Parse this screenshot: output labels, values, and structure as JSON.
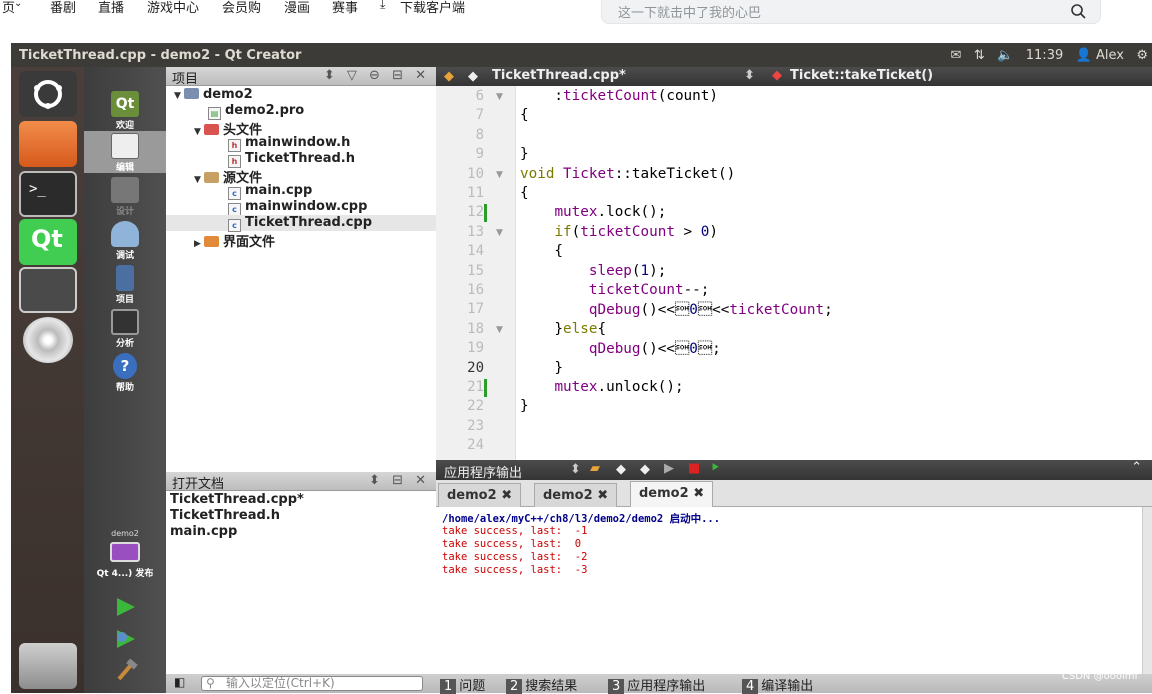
{
  "topnav": {
    "items": [
      "页",
      "番剧",
      "直播",
      "游戏中心",
      "会员购",
      "漫画",
      "赛事",
      "下载客户端"
    ],
    "search_placeholder": "这一下就击中了我的心巴"
  },
  "window": {
    "title": "TicketThread.cpp - demo2 - Qt Creator",
    "clock": "11:39",
    "user": "Alex"
  },
  "modes": [
    {
      "label": "欢迎",
      "color": "#6a8e3a"
    },
    {
      "label": "编辑",
      "color": "#eeeeee"
    },
    {
      "label": "设计",
      "color": "#777777"
    },
    {
      "label": "调试",
      "color": "#8fb3d9"
    },
    {
      "label": "项目",
      "color": "#4a6fa0"
    },
    {
      "label": "分析",
      "color": "#333333"
    },
    {
      "label": "帮助",
      "color": "#3a6fc0"
    }
  ],
  "target": {
    "project": "demo2",
    "kit": "Qt 4...) 发布"
  },
  "project_pane": {
    "title": "项目",
    "tree": [
      {
        "text": "demo2",
        "level": 0,
        "kind": "project",
        "arrow": "▼"
      },
      {
        "text": "demo2.pro",
        "level": 1,
        "kind": "pro",
        "arrow": ""
      },
      {
        "text": "头文件",
        "level": 1,
        "kind": "folder",
        "arrow": "▼"
      },
      {
        "text": "mainwindow.h",
        "level": 2,
        "kind": "h",
        "arrow": ""
      },
      {
        "text": "TicketThread.h",
        "level": 2,
        "kind": "h",
        "arrow": ""
      },
      {
        "text": "源文件",
        "level": 1,
        "kind": "folder",
        "arrow": "▼"
      },
      {
        "text": "main.cpp",
        "level": 2,
        "kind": "cpp",
        "arrow": ""
      },
      {
        "text": "mainwindow.cpp",
        "level": 2,
        "kind": "cpp",
        "arrow": ""
      },
      {
        "text": "TicketThread.cpp",
        "level": 2,
        "kind": "cpp",
        "arrow": "",
        "selected": true
      },
      {
        "text": "界面文件",
        "level": 1,
        "kind": "folder",
        "arrow": "▶"
      }
    ]
  },
  "open_docs": {
    "title": "打开文档",
    "files": [
      "TicketThread.cpp*",
      "TicketThread.h",
      "main.cpp"
    ]
  },
  "editor": {
    "file_tab": "TicketThread.cpp*",
    "symbol": "Ticket::takeTicket()",
    "current_line": 20,
    "lines": [
      {
        "n": 6,
        "code": "    :ticketCount(count)"
      },
      {
        "n": 7,
        "code": "{"
      },
      {
        "n": 8,
        "code": ""
      },
      {
        "n": 9,
        "code": "}"
      },
      {
        "n": 10,
        "code": "void Ticket::takeTicket()"
      },
      {
        "n": 11,
        "code": "{"
      },
      {
        "n": 12,
        "code": "    mutex.lock();"
      },
      {
        "n": 13,
        "code": "    if(ticketCount > 0)"
      },
      {
        "n": 14,
        "code": "    {"
      },
      {
        "n": 15,
        "code": "        sleep(1);"
      },
      {
        "n": 16,
        "code": "        ticketCount--;"
      },
      {
        "n": 17,
        "code": "        qDebug()<<\"take success, last: \"<<ticketCount;"
      },
      {
        "n": 18,
        "code": "    }else{"
      },
      {
        "n": 19,
        "code": "        qDebug()<<\"take failed\";"
      },
      {
        "n": 20,
        "code": "    }"
      },
      {
        "n": 21,
        "code": "    mutex.unlock();"
      },
      {
        "n": 22,
        "code": "}"
      },
      {
        "n": 23,
        "code": ""
      },
      {
        "n": 24,
        "code": ""
      }
    ]
  },
  "output": {
    "title": "应用程序输出",
    "tabs": [
      "demo2",
      "demo2",
      "demo2"
    ],
    "lines": [
      "/home/alex/myC++/ch8/l3/demo2/demo2 启动中...",
      "take success, last:  -1",
      "take success, last:  0",
      "take success, last:  -2",
      "take success, last:  -3"
    ]
  },
  "locator_placeholder": "输入以定位(Ctrl+K)",
  "bottom_tabs": [
    {
      "num": "1",
      "label": "问题"
    },
    {
      "num": "2",
      "label": "搜索结果"
    },
    {
      "num": "3",
      "label": "应用程序输出"
    },
    {
      "num": "4",
      "label": "编译输出"
    }
  ],
  "watermark": "CSDN @ooolmf"
}
